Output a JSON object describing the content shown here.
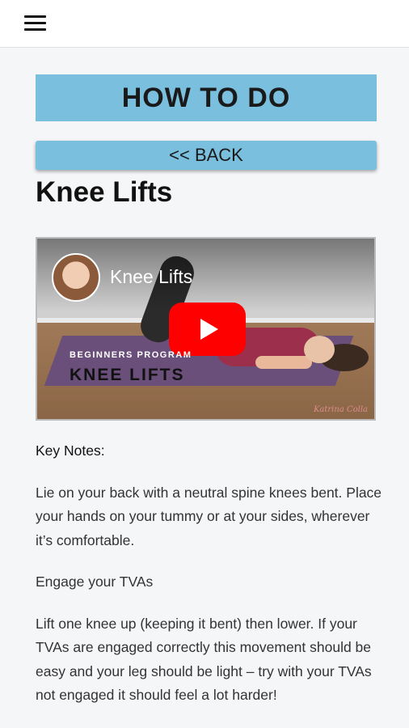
{
  "header": {
    "menu_icon": "hamburger-menu-icon"
  },
  "page": {
    "heading": "HOW TO DO",
    "back_label": "<< BACK",
    "exercise_title": "Knee Lifts"
  },
  "video": {
    "title": "Knee Lifts",
    "overlay_subtitle": "BEGINNERS PROGRAM",
    "overlay_title": "KNEE LIFTS",
    "play_icon": "play-icon",
    "watermark": "Katrina Colla"
  },
  "content": {
    "key_notes_label": "Key Notes:",
    "paragraphs": [
      "Lie on your back with a neutral spine knees bent. Place your hands on your tummy or at your sides, wherever it’s comfortable.",
      "Engage your TVAs",
      "Lift one knee up (keeping it bent) then lower. If your TVAs are engaged correctly this movement should be easy and your leg should be light – try with your TVAs not engaged it should feel a lot harder!"
    ]
  },
  "colors": {
    "accent_blue": "#7bbfde",
    "play_red": "#ff0000"
  }
}
